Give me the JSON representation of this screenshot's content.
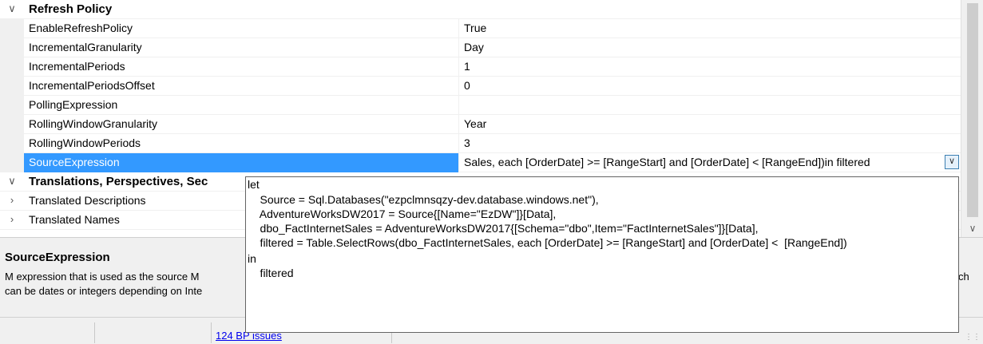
{
  "grid": {
    "category_refresh": "Refresh Policy",
    "properties": [
      {
        "name": "EnableRefreshPolicy",
        "value": "True"
      },
      {
        "name": "IncrementalGranularity",
        "value": "Day"
      },
      {
        "name": "IncrementalPeriods",
        "value": "1"
      },
      {
        "name": "IncrementalPeriodsOffset",
        "value": "0"
      },
      {
        "name": "PollingExpression",
        "value": ""
      },
      {
        "name": "RollingWindowGranularity",
        "value": "Year"
      },
      {
        "name": "RollingWindowPeriods",
        "value": "3"
      },
      {
        "name": "SourceExpression",
        "value": "Sales, each [OrderDate] >= [RangeStart] and [OrderDate] <  [RangeEnd])in    filtered"
      }
    ],
    "category_translations": "Translations, Perspectives, Sec",
    "sub_items": [
      {
        "name": "Translated Descriptions"
      },
      {
        "name": "Translated Names"
      }
    ]
  },
  "popup": {
    "lines": [
      "let",
      "    Source = Sql.Databases(\"ezpclmnsqzy-dev.database.windows.net\"),",
      "    AdventureWorksDW2017 = Source{[Name=\"EzDW\"]}[Data],",
      "    dbo_FactInternetSales = AdventureWorksDW2017{[Schema=\"dbo\",Item=\"FactInternetSales\"]}[Data],",
      "    filtered = Table.SelectRows(dbo_FactInternetSales, each [OrderDate] >= [RangeStart] and [OrderDate] <  [RangeEnd])",
      "in",
      "    filtered"
    ]
  },
  "help": {
    "title": "SourceExpression",
    "desc_line1": "M expression that is used as the source M",
    "desc_line2": "can be dates or integers depending on Inte",
    "desc_right": "ch"
  },
  "statusbar": {
    "link": "124 BP issues"
  }
}
